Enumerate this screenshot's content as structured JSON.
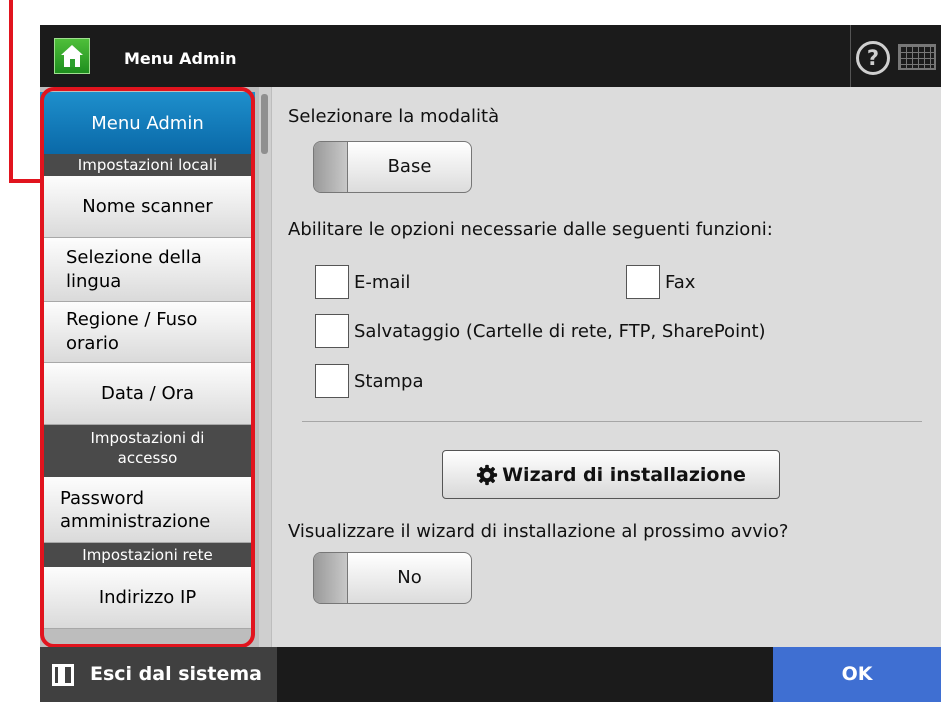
{
  "colors": {
    "highlight_frame": "#e1141e",
    "menu_header": "#1186c8",
    "ok_button": "#3f6fd2",
    "home_button": "#2ea02e"
  },
  "titlebar": {
    "title": "Menu Admin",
    "home_icon": "home-icon",
    "help_icon": "help-icon",
    "keyboard_icon": "keyboard-icon"
  },
  "sidebar": {
    "header": "Menu Admin",
    "sections": [
      {
        "title": "Impostazioni locali"
      },
      {
        "title": "Impostazioni di accesso"
      },
      {
        "title": "Impostazioni rete"
      }
    ],
    "items": [
      "Nome scanner",
      "Selezione della lingua",
      "Regione / Fuso orario",
      "Data / Ora",
      "Password amministrazione",
      "Indirizzo IP"
    ]
  },
  "main": {
    "mode_label": "Selezionare la modalità",
    "mode_value": "Base",
    "functions_label": "Abilitare le opzioni necessarie dalle seguenti funzioni:",
    "options": [
      {
        "label": "E-mail",
        "checked": false
      },
      {
        "label": "Fax",
        "checked": false
      },
      {
        "label": "Salvataggio (Cartelle di rete, FTP, SharePoint)",
        "checked": false
      },
      {
        "label": "Stampa",
        "checked": false
      }
    ],
    "wizard_button": "Wizard di installazione",
    "wizard_icon": "gear-icon",
    "wizard_question": "Visualizzare il wizard di installazione al prossimo avvio?",
    "wizard_toggle_value": "No"
  },
  "footer": {
    "logout": "Esci dal sistema",
    "logout_icon": "logout-door-icon",
    "ok": "OK"
  }
}
